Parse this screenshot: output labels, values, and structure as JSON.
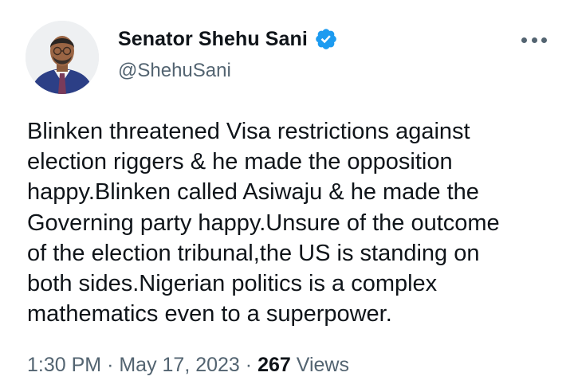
{
  "author": {
    "display_name": "Senator Shehu Sani",
    "handle": "@ShehuSani",
    "verified": true
  },
  "tweet": {
    "text": "Blinken threatened Visa restrictions against\nelection riggers & he made the opposition\nhappy.Blinken called Asiwaju & he made the\nGoverning party happy.Unsure of the outcome\nof the election tribunal,the US is standing on\nboth sides.Nigerian politics is a complex\nmathematics even to a superpower."
  },
  "meta": {
    "time": "1:30 PM",
    "separator": "·",
    "date": "May 17, 2023",
    "views_count": "267",
    "views_label": "Views"
  },
  "icons": {
    "verified": "verified-badge-icon",
    "more": "more-options-icon"
  },
  "colors": {
    "verified_blue": "#1d9bf0",
    "text_primary": "#0f1419",
    "text_secondary": "#536471"
  }
}
